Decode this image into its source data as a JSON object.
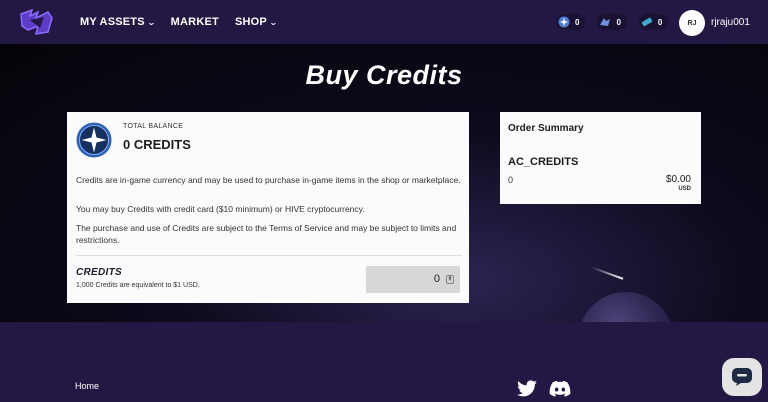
{
  "nav": {
    "links": [
      {
        "label": "MY ASSETS",
        "has_dropdown": true
      },
      {
        "label": "MARKET",
        "has_dropdown": false
      },
      {
        "label": "SHOP",
        "has_dropdown": true
      }
    ],
    "counters": [
      {
        "icon": "credits-icon",
        "value": "0"
      },
      {
        "icon": "voucher-icon",
        "value": "0"
      },
      {
        "icon": "ticket-icon",
        "value": "0"
      }
    ],
    "avatar_initials": "RJ",
    "username": "rjraju001"
  },
  "page": {
    "title": "Buy Credits"
  },
  "balance": {
    "label": "TOTAL BALANCE",
    "value": "0 CREDITS"
  },
  "info": {
    "p1": "Credits are in-game currency and may be used to purchase in-game items in the shop or marketplace.",
    "p2": "You may buy Credits with credit card ($10 minimum) or HIVE cryptocurrency.",
    "p3": "The purchase and use of Credits are subject to the Terms of Service and may be subject to limits and restrictions."
  },
  "purchase": {
    "label": "CREDITS",
    "subtext": "1,000 Credits are equivalent to $1 USD.",
    "quantity": "0"
  },
  "order_summary": {
    "title": "Order Summary",
    "item": "AC_CREDITS",
    "quantity": "0",
    "price": "$0.00",
    "currency": "USD"
  },
  "footer": {
    "home_label": "Home",
    "social": [
      "twitter-icon",
      "discord-icon"
    ]
  },
  "colors": {
    "nav_bg": "#231844",
    "accent": "#7b5cff",
    "card_bg": "#fbfbfd"
  }
}
